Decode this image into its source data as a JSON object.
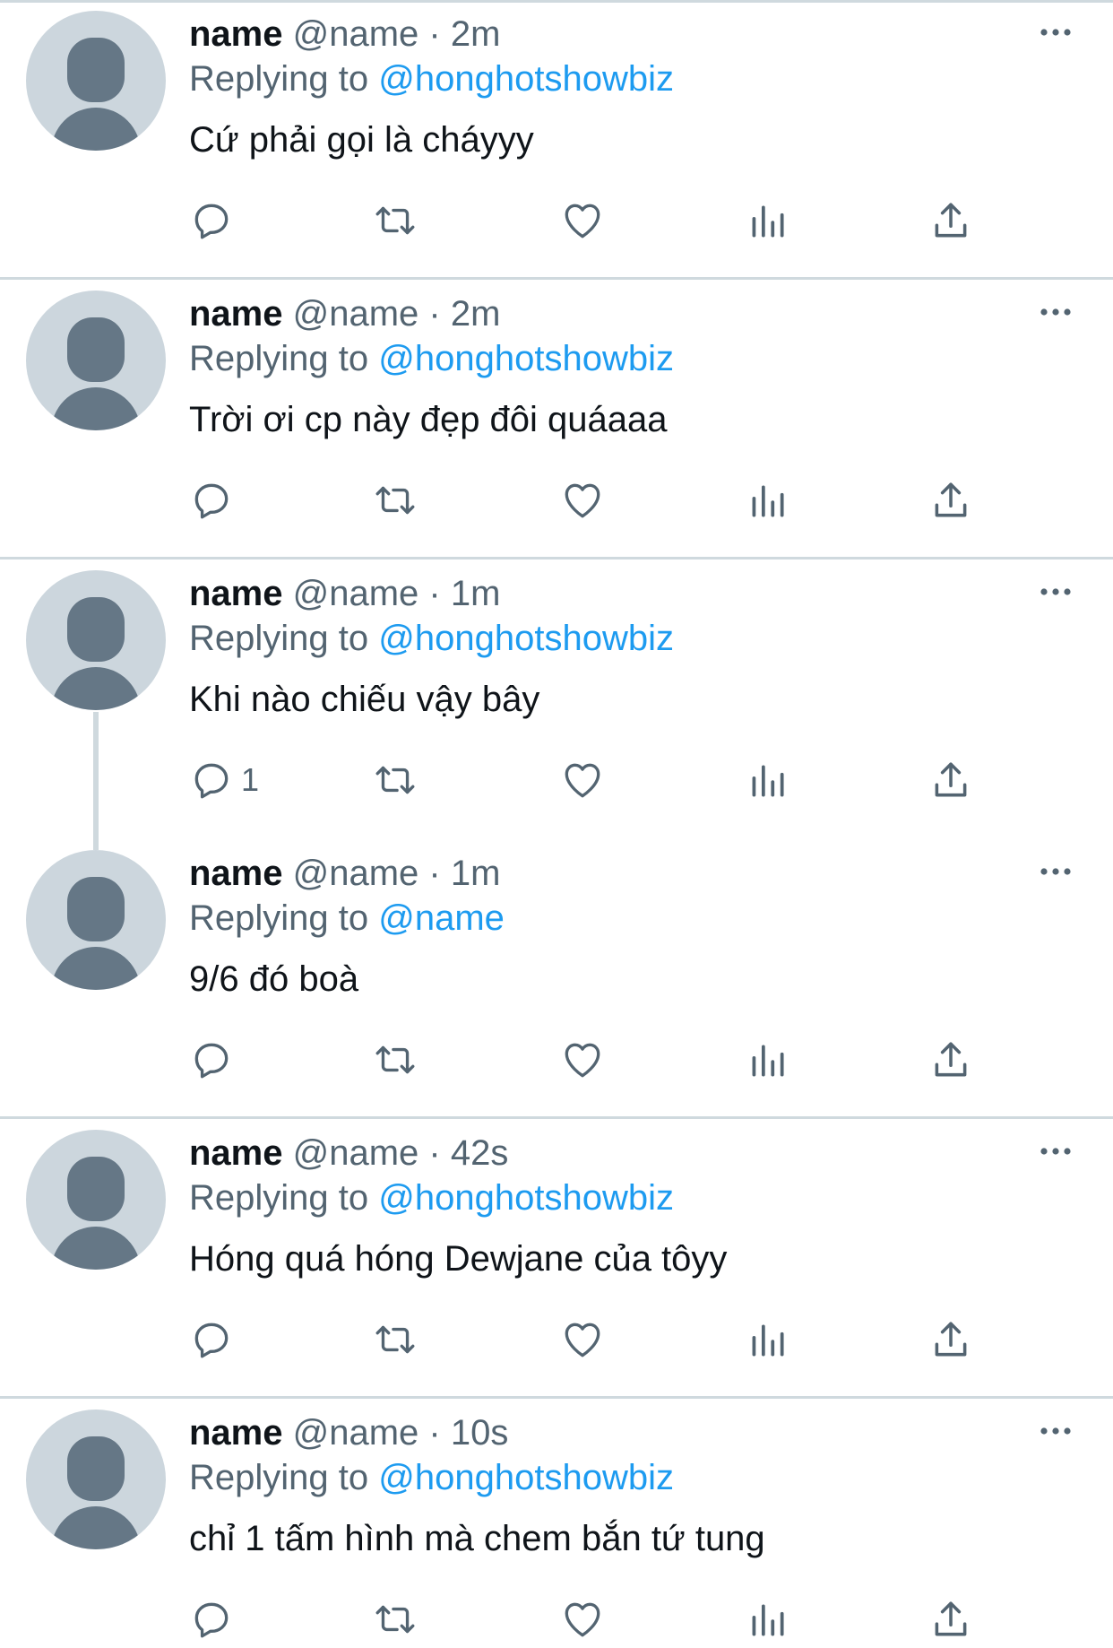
{
  "colors": {
    "text": "#0f1419",
    "secondary": "#536471",
    "link": "#1d9bf0",
    "divider": "#cfd9de",
    "avatar_bg": "#ccd6dd",
    "avatar_fg": "#657786"
  },
  "icons": {
    "reply": "reply-icon",
    "retweet": "retweet-icon",
    "like": "heart-icon",
    "stats": "analytics-icon",
    "share": "share-icon",
    "more": "more-icon"
  },
  "tweets": [
    {
      "name": "name",
      "handle": "@name",
      "dot": "·",
      "time": "2m",
      "replying_label": "Replying to",
      "replying_to": "@honghotshowbiz",
      "text": "Cứ phải gọi là cháyyy",
      "reply_count": ""
    },
    {
      "name": "name",
      "handle": "@name",
      "dot": "·",
      "time": "2m",
      "replying_label": "Replying to",
      "replying_to": "@honghotshowbiz",
      "text": "Trời ơi cp này đẹp đôi quáaaa",
      "reply_count": ""
    },
    {
      "name": "name",
      "handle": "@name",
      "dot": "·",
      "time": "1m",
      "replying_label": "Replying to",
      "replying_to": "@honghotshowbiz",
      "text": "Khi nào chiếu vậy bây",
      "reply_count": "1"
    },
    {
      "name": "name",
      "handle": "@name",
      "dot": "·",
      "time": "1m",
      "replying_label": "Replying to",
      "replying_to": "@name",
      "text": "9/6 đó boà",
      "reply_count": ""
    },
    {
      "name": "name",
      "handle": "@name",
      "dot": "·",
      "time": "42s",
      "replying_label": "Replying to",
      "replying_to": "@honghotshowbiz",
      "text": "Hóng quá hóng Dewjane của tôyy",
      "reply_count": ""
    },
    {
      "name": "name",
      "handle": "@name",
      "dot": "·",
      "time": "10s",
      "replying_label": "Replying to",
      "replying_to": "@honghotshowbiz",
      "text": "chỉ 1 tấm hình mà chem bắn tứ tung",
      "reply_count": ""
    }
  ]
}
